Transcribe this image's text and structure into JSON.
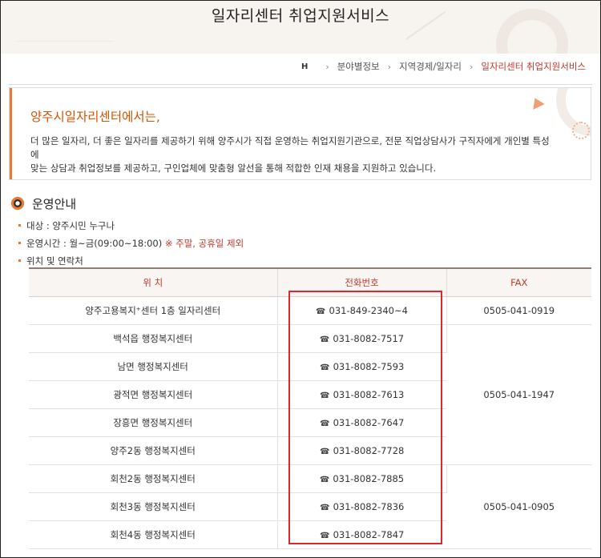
{
  "banner": {
    "title": "일자리센터 취업지원서비스"
  },
  "breadcrumb": {
    "home": "H",
    "items": [
      "분야별정보",
      "지역경제/일자리",
      "일자리센터 취업지원서비스"
    ]
  },
  "intro": {
    "title": "양주시일자리센터에서는,",
    "line1": "더 많은 일자리, 더 좋은 일자리를 제공하기 위해 양주시가 직접 운영하는 취업지원기관으로, 전문 직업상담사가 구직자에게 개인별 특성에",
    "line2": "맞는 상담과 취업정보를 제공하고, 구인업체에 맞춤형 알선을 통해 적합한 인재 채용을 지원하고 있습니다."
  },
  "section": {
    "title": "운영안내",
    "items": {
      "target": "대상 : 양주시민 누구나",
      "hours": "운영시간 : 월~금(09:00~18:00)",
      "hours_note": "※ 주말, 공휴일 제외",
      "location": "위치 및 연락처"
    }
  },
  "table": {
    "headers": {
      "location": "위 치",
      "phone": "전화번호",
      "fax": "FAX"
    },
    "phone_icon": "☎",
    "rows": [
      {
        "location": "양주고용복지⁺센터 1층 일자리센터",
        "phone": "031-849-2340~4"
      },
      {
        "location": "백석읍 행정복지센터",
        "phone": "031-8082-7517"
      },
      {
        "location": "남면 행정복지센터",
        "phone": "031-8082-7593"
      },
      {
        "location": "광적면 행정복지센터",
        "phone": "031-8082-7613"
      },
      {
        "location": "장흥면 행정복지센터",
        "phone": "031-8082-7647"
      },
      {
        "location": "양주2동 행정복지센터",
        "phone": "031-8082-7728"
      },
      {
        "location": "회천2동 행정복지센터",
        "phone": "031-8082-7885"
      },
      {
        "location": "회천3동 행정복지센터",
        "phone": "031-8082-7836"
      },
      {
        "location": "회천4동 행정복지센터",
        "phone": "031-8082-7847"
      }
    ],
    "fax": [
      "0505-041-0919",
      "0505-041-1947",
      "0505-041-0905"
    ]
  },
  "colors": {
    "accent": "#e07b39",
    "highlight": "#e0242b",
    "current": "#c0392b"
  }
}
